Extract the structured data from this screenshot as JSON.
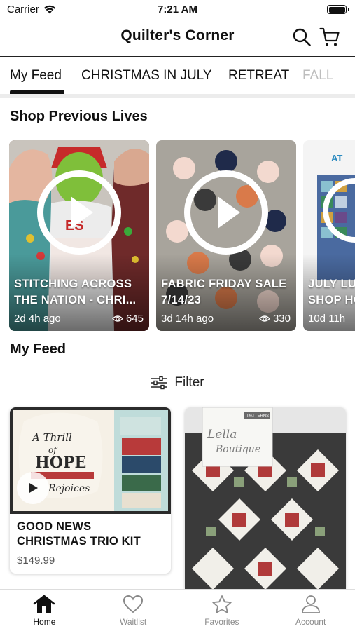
{
  "status_bar": {
    "carrier": "Carrier",
    "time": "7:21 AM"
  },
  "header": {
    "title": "Quilter's Corner"
  },
  "tabs": [
    {
      "label": "My Feed",
      "active": true
    },
    {
      "label": "CHRISTMAS IN JULY",
      "active": false
    },
    {
      "label": "RETREAT",
      "active": false
    },
    {
      "label": "FALL",
      "active": false
    }
  ],
  "previous_lives": {
    "title": "Shop Previous Lives",
    "items": [
      {
        "title_line1": "STITCHING ACROSS",
        "title_line2": "THE NATION - CHRI...",
        "ago": "2d 4h ago",
        "views": "645"
      },
      {
        "title_line1": "FABRIC FRIDAY SALE",
        "title_line2": "7/14/23",
        "ago": "3d 14h ago",
        "views": "330"
      },
      {
        "title_line1": "JULY LUC",
        "title_line2": "SHOP HO",
        "ago": "10d 11h",
        "views": ""
      }
    ]
  },
  "feed": {
    "title": "My Feed",
    "filter_label": "Filter",
    "products": [
      {
        "name_line1": "GOOD NEWS",
        "name_line2": "CHRISTMAS TRIO KIT",
        "price": "$149.99",
        "image_text": "A Thrill of HOPE The Weary World Rejoices"
      },
      {
        "name_line1": "",
        "name_line2": "",
        "price": "",
        "image_text": "Lella Boutique",
        "badge": "PATTERNS"
      }
    ]
  },
  "bottom_nav": [
    {
      "label": "Home",
      "icon": "home-icon",
      "active": true
    },
    {
      "label": "Waitlist",
      "icon": "heart-icon",
      "active": false
    },
    {
      "label": "Favorites",
      "icon": "star-icon",
      "active": false
    },
    {
      "label": "Account",
      "icon": "person-icon",
      "active": false
    }
  ],
  "colors": {
    "accent": "#111111",
    "inactive": "#8a8a8a"
  }
}
